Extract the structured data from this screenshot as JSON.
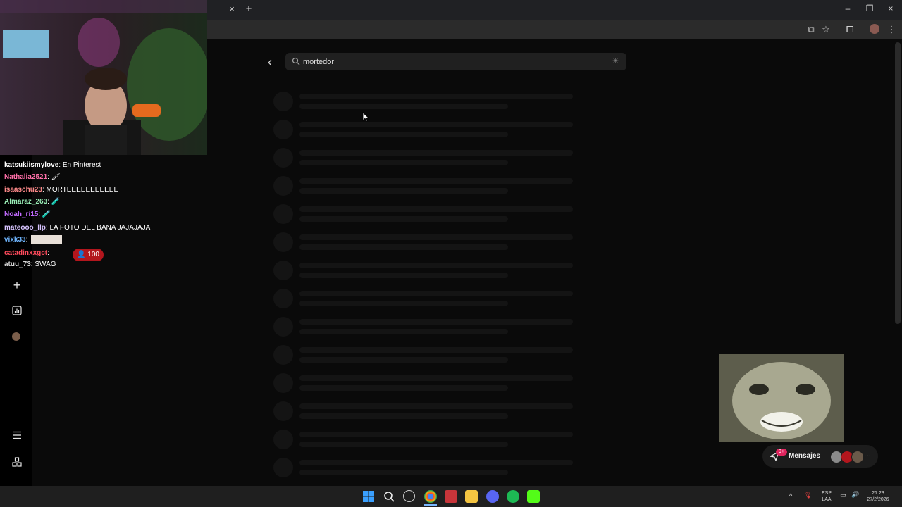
{
  "browser": {
    "close_tab_glyph": "×",
    "new_tab_glyph": "+",
    "window_controls": [
      "–",
      "❐",
      "×"
    ]
  },
  "search": {
    "value": "mortedor",
    "placeholder": ""
  },
  "sidebar": {
    "icons": [
      "search-icon",
      "heart-icon",
      "create-icon",
      "dashboard-icon",
      "profile-avatar",
      "menu-icon",
      "more-icon"
    ]
  },
  "chat": {
    "lines": [
      {
        "user": "katsukiismylove",
        "text": "En Pinterest",
        "color": "#ffffff"
      },
      {
        "user": "Nathalia2521",
        "text": "🖌",
        "color": "#ff6fa8"
      },
      {
        "user": "isaaschu23",
        "text": "MORTEEEEEEEEEEE",
        "color": "#ff8a8a"
      },
      {
        "user": "Almaraz_263",
        "text": "🧪",
        "color": "#9bf0b8"
      },
      {
        "user": "Noah_ri15",
        "text": "🧪",
        "color": "#c26bff"
      },
      {
        "user": "mateooo_llp",
        "text": "LA FOTO DEL BANA JAJAJAJA",
        "color": "#d7c4ff"
      },
      {
        "user": "vixk33",
        "text": "",
        "color": "#6fb6ff"
      },
      {
        "user": "catadinxxgct",
        "text": "",
        "color": "#ff4b5c"
      },
      {
        "user": "atuu_73",
        "text": "SWAG",
        "color": "#d8d8d8"
      }
    ],
    "live_badge": "100"
  },
  "messages": {
    "label": "Mensajes",
    "badge": "9+"
  },
  "taskbar": {
    "lang_top": "ESP",
    "lang_bottom": "LAA",
    "time": "21:23",
    "date": "27/2/2026"
  }
}
